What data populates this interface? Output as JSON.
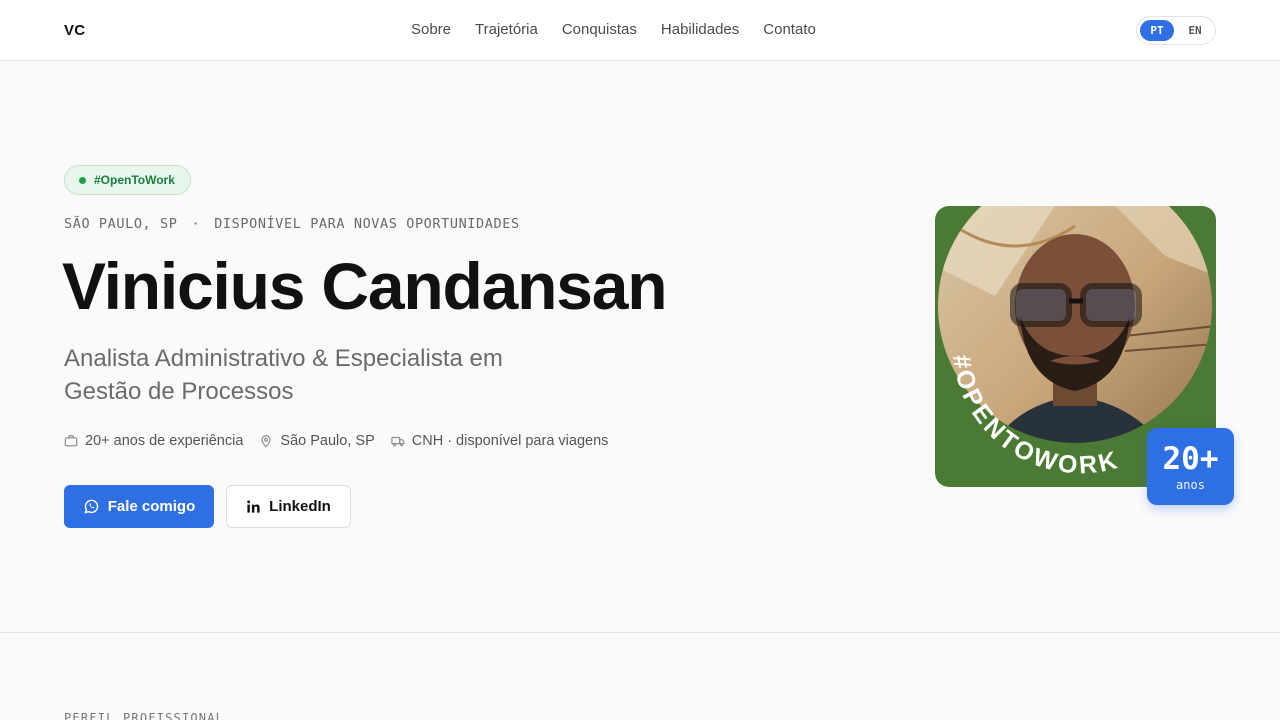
{
  "header": {
    "logo": "VC",
    "nav": [
      "Sobre",
      "Trajetória",
      "Conquistas",
      "Habilidades",
      "Contato"
    ],
    "lang": {
      "pt": "PT",
      "en": "EN",
      "active": "PT"
    }
  },
  "hero": {
    "badge": "#OpenToWork",
    "kicker_location": "SÃO PAULO, SP",
    "kicker_separator": "·",
    "kicker_status": "DISPONÍVEL PARA NOVAS OPORTUNIDADES",
    "name": "Vinicius Candansan",
    "subtitle": "Analista Administrativo & Especialista em Gestão de Processos",
    "facts": [
      {
        "icon": "briefcase-icon",
        "text": "20+ anos de experiência"
      },
      {
        "icon": "map-pin-icon",
        "text": "São Paulo, SP"
      },
      {
        "icon": "truck-icon",
        "text": "CNH · disponível para viagens"
      }
    ],
    "primary_button": "Fale comigo",
    "secondary_button": "LinkedIn",
    "photo_frame_text": "#OPENTOWORK",
    "years_badge": {
      "value": "20+",
      "label": "anos"
    }
  },
  "next_section": {
    "kicker": "PERFIL PROFISSIONAL"
  },
  "colors": {
    "accent": "#2f6fe4",
    "badge_green": "#1a7f3e",
    "frame_green": "#4a7a33"
  }
}
